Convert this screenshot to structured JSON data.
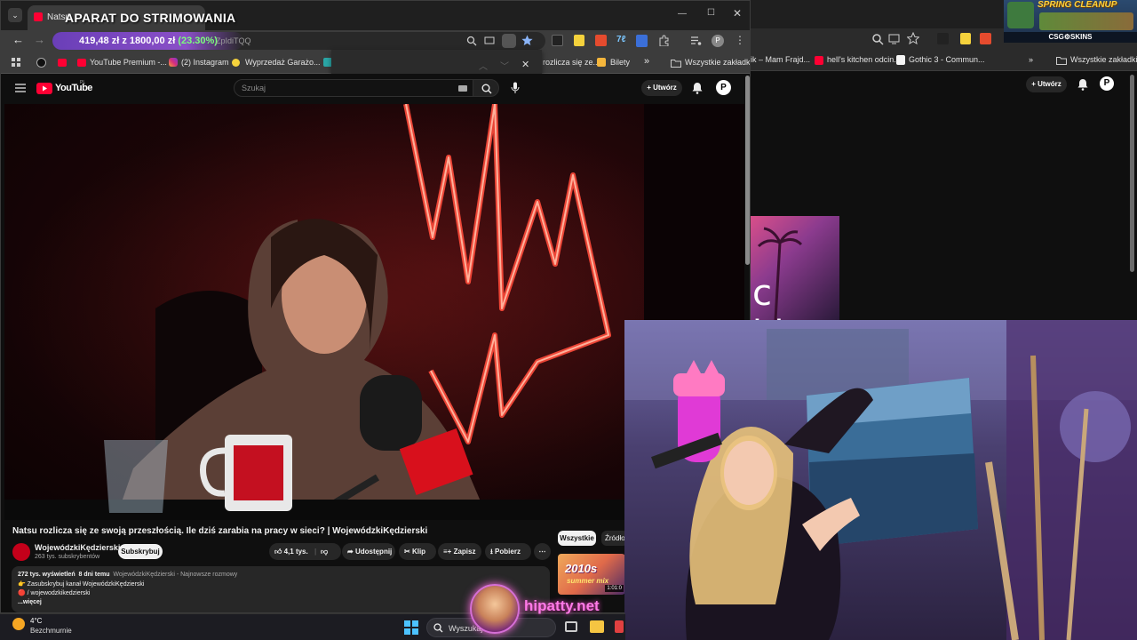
{
  "stream": {
    "title": "APARAT DO STRIMOWANIA",
    "price_main": "419,48 zł",
    "price_target": "z 1800,00 zł",
    "price_change": "(23.30%)",
    "url_fragment": "ZpIdiTQQ",
    "overlay_spring": "SPRING CLEANUP",
    "overlay_sponsor": "CSG⚙SKINS",
    "watermark": "hipatty.net"
  },
  "browser": {
    "tab_title": "Natsu",
    "bookmarks": [
      {
        "label": "YouTube Premium -..."
      },
      {
        "label": "(2) Instagram"
      },
      {
        "label": "Wyprzedaż Garażo..."
      },
      {
        "label": "rozlicza się ze..."
      },
      {
        "label": "Bilety"
      },
      {
        "label": "Wszystkie zakładki"
      }
    ],
    "profile_initial": "P"
  },
  "bg_browser": {
    "bookmarks": [
      {
        "label": "ik – Mam Frajd..."
      },
      {
        "label": "hell's kitchen odcin..."
      },
      {
        "label": "Gothic 3 - Commun..."
      },
      {
        "label": "Wszystkie zakładki"
      }
    ],
    "create_label": "Utwórz",
    "music_text": "c hits"
  },
  "youtube": {
    "logo": "YouTube",
    "logo_region": "PL",
    "search_placeholder": "Szukaj",
    "create_label": "Utwórz",
    "video_title": "Natsu rozlicza się ze swoją przeszłością. Ile dziś zarabia na pracy w sieci? | WojewódzkiKędzierski",
    "channel_name": "WojewódzkiKędzierski",
    "channel_subs": "263 tys. subskrybentów",
    "subscribe": "Subskrybuj",
    "likes": "4,1 tys.",
    "share": "Udostępnij",
    "clip": "Klip",
    "save": "Zapisz",
    "download": "Pobierz",
    "description": {
      "meta_views": "272 tys. wyświetleń",
      "meta_age": "8 dni temu",
      "meta_tags": "WojewódzkiKędzierski - Najnowsze rozmowy",
      "line2": "Zasubskrybuj kanał WojewódzkiKędzierski",
      "line3": "/ wojewodzkikedzierski",
      "more": "...więcej"
    },
    "filters": [
      "Wszystkie",
      "Źródło:"
    ],
    "rec_title": "2010s",
    "rec_sub": "summer mix",
    "rec_duration": "1:01:0"
  },
  "taskbar": {
    "temperature": "4°C",
    "weather": "Bezchmurnie",
    "search": "Wyszukaj"
  }
}
